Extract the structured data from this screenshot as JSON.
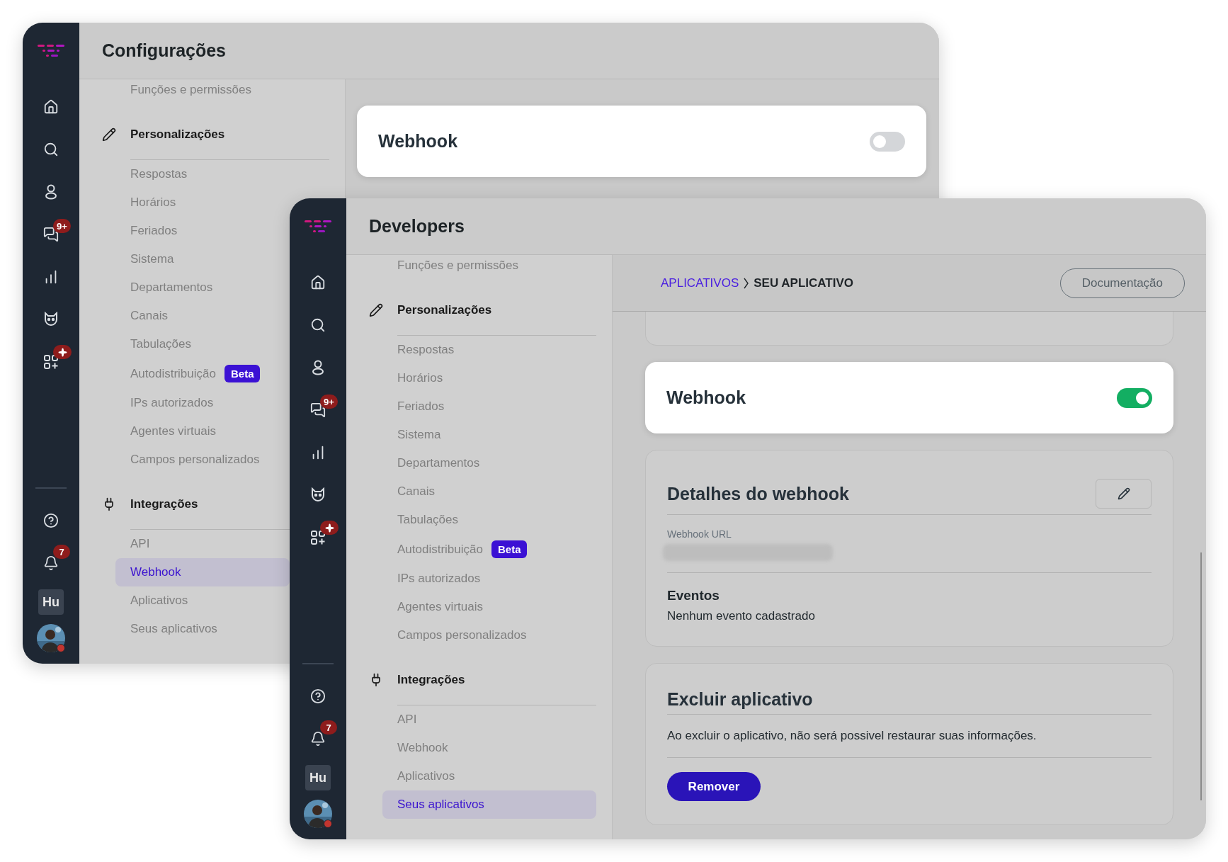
{
  "windows": [
    {
      "title": "Configurações",
      "sidebar": {
        "items": [
          {
            "kind": "home"
          },
          {
            "kind": "search"
          },
          {
            "kind": "contacts"
          },
          {
            "kind": "chats",
            "badge": "9+"
          },
          {
            "kind": "reports"
          },
          {
            "kind": "bot"
          },
          {
            "kind": "apps",
            "alert": true
          }
        ],
        "bottom": [
          {
            "kind": "help"
          },
          {
            "kind": "notifications",
            "badge": "7"
          },
          {
            "kind": "workspace",
            "label": "Hu"
          },
          {
            "kind": "avatar",
            "status": true
          }
        ]
      },
      "nav": {
        "top_item": "Funções e permissões",
        "sections": [
          {
            "title": "Personalizações",
            "kind": "pencil",
            "items": [
              {
                "label": "Respostas",
                "selected": false
              },
              {
                "label": "Horários",
                "selected": false
              },
              {
                "label": "Feriados",
                "selected": false
              },
              {
                "label": "Sistema",
                "selected": false
              },
              {
                "label": "Departamentos",
                "selected": false
              },
              {
                "label": "Canais",
                "selected": false
              },
              {
                "label": "Tabulações",
                "selected": false
              },
              {
                "label": "Autodistribuição",
                "selected": false,
                "badge": "Beta"
              },
              {
                "label": "IPs autorizados",
                "selected": false
              },
              {
                "label": "Agentes virtuais",
                "selected": false
              },
              {
                "label": "Campos personalizados",
                "selected": false
              }
            ]
          },
          {
            "title": "Integrações",
            "kind": "plug",
            "items": [
              {
                "label": "API",
                "selected": false
              },
              {
                "label": "Webhook",
                "selected": true
              },
              {
                "label": "Aplicativos",
                "selected": false
              },
              {
                "label": "Seus aplicativos",
                "selected": false
              }
            ]
          }
        ]
      },
      "content": {
        "cards": [
          {
            "kind": "toggle",
            "title": "Webhook",
            "on": false
          }
        ]
      }
    },
    {
      "title": "Developers",
      "sidebar": {
        "items": [
          {
            "kind": "home"
          },
          {
            "kind": "search"
          },
          {
            "kind": "contacts"
          },
          {
            "kind": "chats",
            "badge": "9+"
          },
          {
            "kind": "reports"
          },
          {
            "kind": "bot"
          },
          {
            "kind": "apps",
            "alert": true
          }
        ],
        "bottom": [
          {
            "kind": "help"
          },
          {
            "kind": "notifications",
            "badge": "7"
          },
          {
            "kind": "workspace",
            "label": "Hu"
          },
          {
            "kind": "avatar",
            "status": true
          }
        ]
      },
      "nav": {
        "top_item": "Funções e permissões",
        "sections": [
          {
            "title": "Personalizações",
            "kind": "pencil",
            "items": [
              {
                "label": "Respostas",
                "selected": false
              },
              {
                "label": "Horários",
                "selected": false
              },
              {
                "label": "Feriados",
                "selected": false
              },
              {
                "label": "Sistema",
                "selected": false
              },
              {
                "label": "Departamentos",
                "selected": false
              },
              {
                "label": "Canais",
                "selected": false
              },
              {
                "label": "Tabulações",
                "selected": false
              },
              {
                "label": "Autodistribuição",
                "selected": false,
                "badge": "Beta"
              },
              {
                "label": "IPs autorizados",
                "selected": false
              },
              {
                "label": "Agentes virtuais",
                "selected": false
              },
              {
                "label": "Campos personalizados",
                "selected": false
              }
            ]
          },
          {
            "title": "Integrações",
            "kind": "plug",
            "items": [
              {
                "label": "API",
                "selected": false
              },
              {
                "label": "Webhook",
                "selected": false
              },
              {
                "label": "Aplicativos",
                "selected": false
              },
              {
                "label": "Seus aplicativos",
                "selected": true
              }
            ]
          }
        ]
      },
      "content": {
        "breadcrumb": [
          {
            "label": "APLICATIVOS",
            "kind": "link"
          },
          {
            "label": "SEU APLICATIVO",
            "kind": "current"
          }
        ],
        "doc_button": "Documentação",
        "cards": [
          {
            "kind": "blank"
          },
          {
            "kind": "toggle",
            "title": "Webhook",
            "on": true
          },
          {
            "kind": "details",
            "title": "Detalhes do webhook",
            "url_label": "Webhook URL",
            "events_title": "Eventos",
            "events_text": "Nenhum evento cadastrado"
          },
          {
            "kind": "danger",
            "title": "Excluir aplicativo",
            "text": "Ao excluir o aplicativo, não será possivel restaurar suas informações.",
            "button": "Remover"
          }
        ]
      }
    }
  ]
}
